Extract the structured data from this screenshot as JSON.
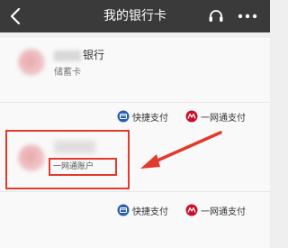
{
  "header": {
    "title": "我的银行卡"
  },
  "cards": [
    {
      "bank_name_suffix": "银行",
      "card_type": "储蓄卡",
      "payments": [
        {
          "label": "快捷支付",
          "icon": "quickpay-icon"
        },
        {
          "label": "一网通支付",
          "icon": "yiwangtong-icon"
        }
      ]
    },
    {
      "account_type": "一网通账户",
      "payments": [
        {
          "label": "快捷支付",
          "icon": "quickpay-icon"
        },
        {
          "label": "一网通支付",
          "icon": "yiwangtong-icon"
        }
      ]
    }
  ],
  "colors": {
    "header_bg": "#3a3a3a",
    "highlight": "#e23a2c",
    "quickpay_blue": "#2b5fb0",
    "yiwangtong_red": "#c8102e"
  }
}
